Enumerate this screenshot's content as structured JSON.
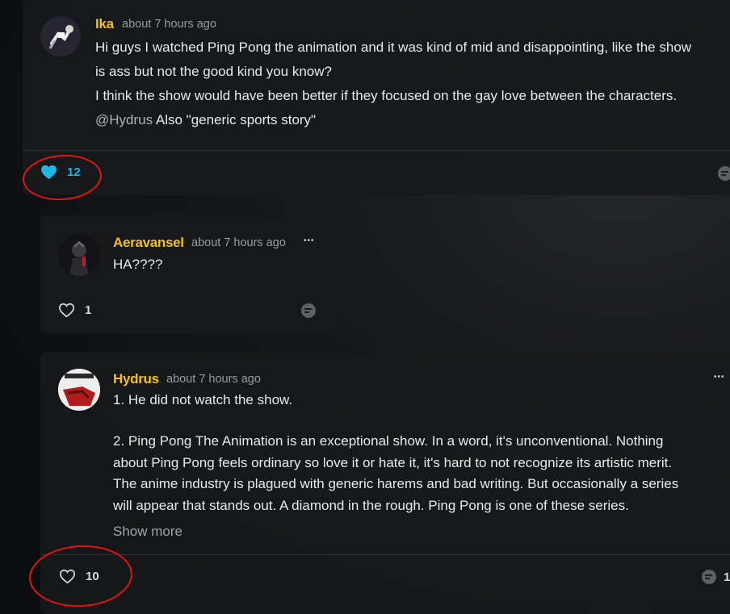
{
  "comments": [
    {
      "author": "Ika",
      "time": "about 7 hours ago",
      "lines": [
        "Hi guys I watched Ping Pong the animation and it was kind of mid and disappointing, like the show",
        "is ass but not the good kind you know?",
        "I think the show would have been better if they focused on the gay love between the characters."
      ],
      "mention": "@Hydrus",
      "mention_text": " Also \"generic sports story\"",
      "likes": "12",
      "liked": true
    },
    {
      "author": "Aeravansel",
      "time": "about 7 hours ago",
      "text": "HA????",
      "likes": "1",
      "liked": false
    },
    {
      "author": "Hydrus",
      "time": "about 7 hours ago",
      "para1": "1. He did not watch the show.",
      "para2_lines": [
        "2. Ping Pong The Animation is an exceptional show. In a word, it's unconventional. Nothing",
        "about Ping Pong feels ordinary so love it or hate it, it's hard to not recognize its artistic merit.",
        "The anime industry is plagued with generic harems and bad writing. But occasionally a series",
        "will appear that stands out. A diamond in the rough. Ping Pong is one of these series."
      ],
      "show_more": "Show more",
      "likes": "10",
      "liked": false,
      "comment_count": "1"
    }
  ],
  "more_glyph": "•••",
  "colors": {
    "author": "#f2c21b",
    "liked": "#1fb6e6",
    "annotation": "#e21414"
  }
}
